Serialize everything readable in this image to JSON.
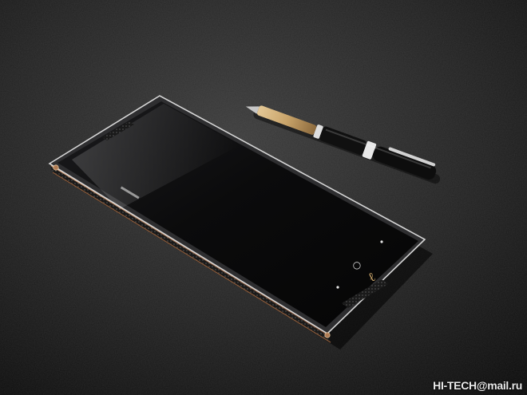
{
  "photo": {
    "subject": "smartphone-and-pen-on-leather",
    "colors": {
      "background": "#1a1a1a",
      "screen": "#0b0b0c",
      "frame": "#3a3a3c",
      "bronze_trim": "#b0754f",
      "chrome": "#d9d9d9",
      "pen_body": "#101010",
      "pen_gold": "#c9a46a"
    }
  },
  "phone": {
    "logo_glyph": "ℓ",
    "home_glyph": "○"
  },
  "watermark": {
    "prefix": "HI-TECH",
    "at": "@",
    "suffix": "mail.ru"
  }
}
